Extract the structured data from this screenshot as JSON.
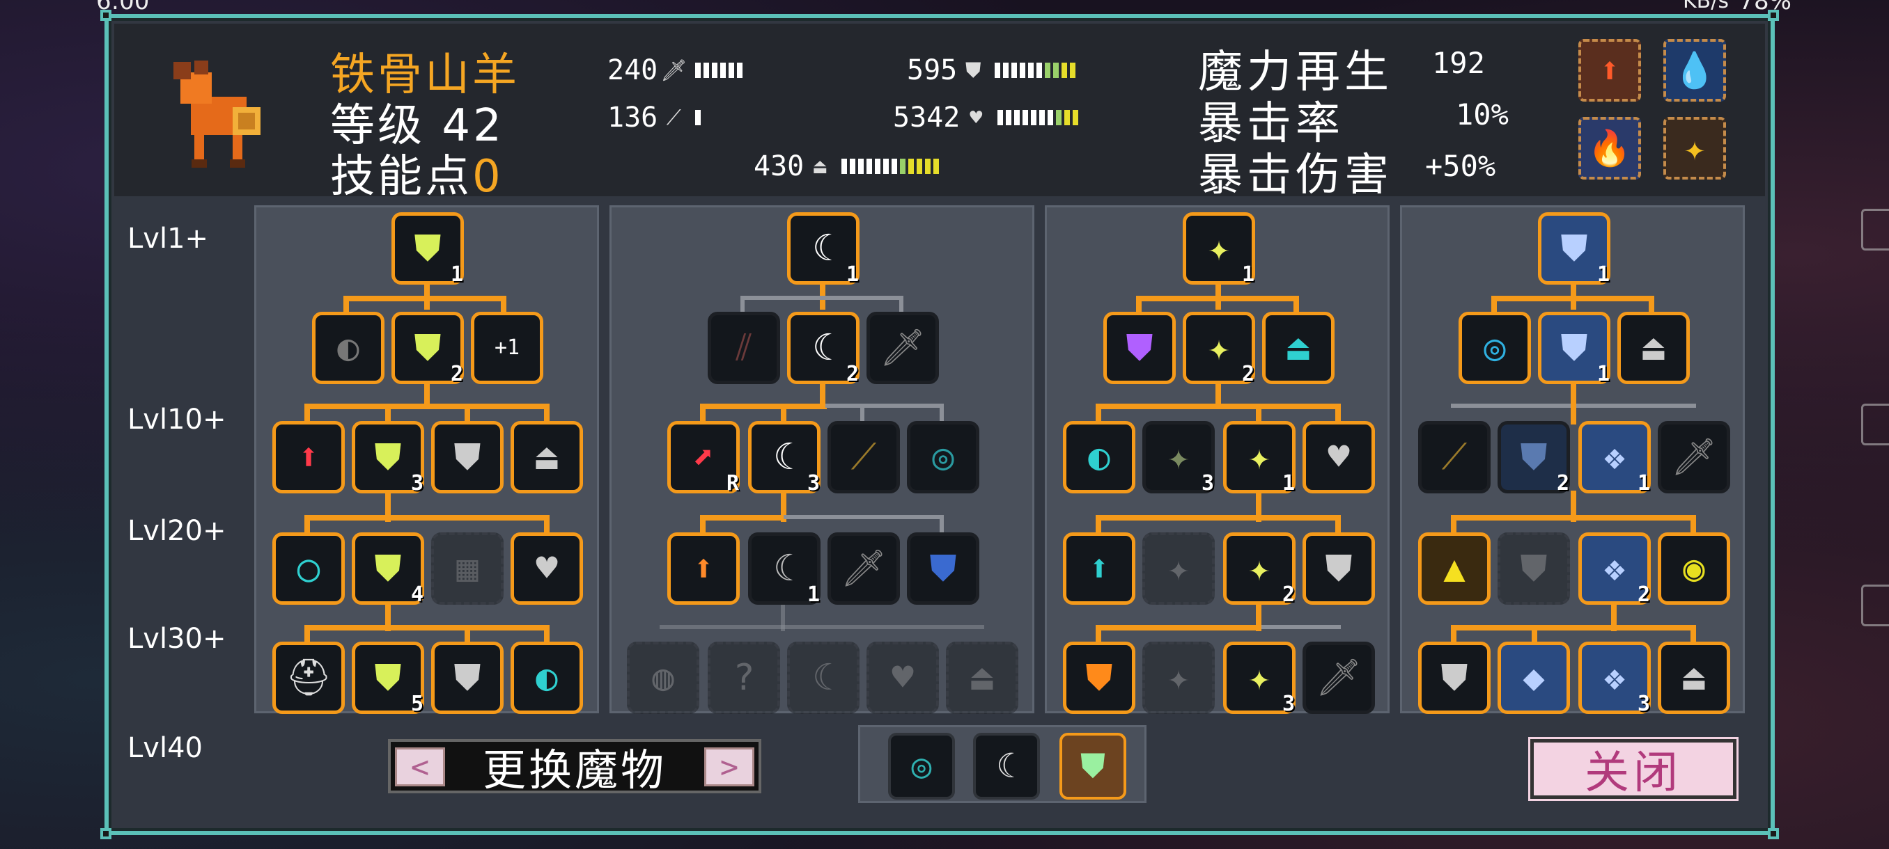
{
  "status": {
    "time": "6:00",
    "net": "KB/s",
    "battery": "78%"
  },
  "monster": {
    "name": "铁骨山羊",
    "level_label": "等级",
    "level": "42",
    "skill_points_label": "技能点",
    "skill_points": "0"
  },
  "stats": {
    "attack": "240",
    "attack_icon": "sword-icon",
    "speed": "136",
    "speed_icon": "wand-icon",
    "defense": "595",
    "defense_icon": "shield-icon",
    "hp": "5342",
    "hp_icon": "heart-icon",
    "mana": "430",
    "mana_icon": "potion-icon"
  },
  "right_stats": {
    "mana_regen_label": "魔力再生",
    "mana_regen": "192",
    "crit_rate_label": "暴击率",
    "crit_rate": "10%",
    "crit_dmg_label": "暴击伤害",
    "crit_dmg": "+50%"
  },
  "levels": [
    "Lvl1+",
    "Lvl10+",
    "Lvl20+",
    "Lvl30+",
    "Lvl40"
  ],
  "buttons": {
    "swap": "更换魔物",
    "prev": "<",
    "next": ">",
    "close": "关闭"
  },
  "node_badges": {
    "plus1": "+1",
    "r": "R"
  },
  "colors": {
    "accent": "#f59a1a",
    "frame": "#5bc0b8",
    "name": "#f5a623",
    "close_text": "#b13a7c"
  }
}
